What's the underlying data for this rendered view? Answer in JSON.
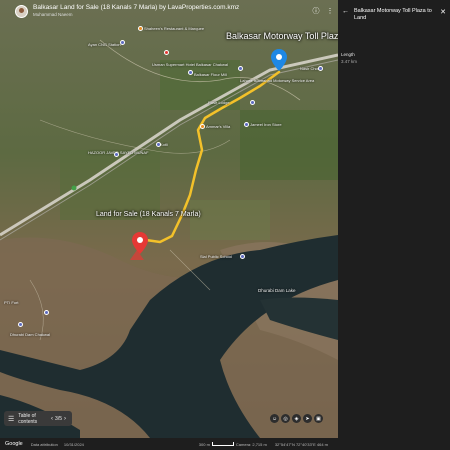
{
  "header": {
    "title": "Balkasar Land for Sale (18 Kanals 7 Marla) by LavaProperties.com.kmz",
    "user": "Muhammad Naeem"
  },
  "map": {
    "labels": {
      "toll_plaza": "Balkasar Motorway Toll Plaza",
      "land_for_sale": "Land for Sale (18 Kanals 7 Marla)",
      "shaheen_restaurant": "Shaheen's Restaurant & Marquee",
      "motorway_service": "Lahore Islamabad Motorway Service Area",
      "usman_mart": "Usman Supermart Hotel Balkasar Chakwal",
      "ayan_cng": "Ayan CNG Station",
      "gym": "Gym",
      "balkasar_mill": "Balkasar Flour Mill",
      "nasir_chowk": "Nasir Chowk",
      "rose_lodge": "Rose Lodge",
      "balkasar_motorway": "Balkasar Motorway",
      "rest_area": "Rest Area",
      "ammar_villa": "Ammar's Villa",
      "jameel_iron": "Jameel Iron Store",
      "hazoor_javed": "HAZOOR JAVED SAYED MUNAF",
      "kotli": "Kotli",
      "sial_public": "Sial Public School",
      "balkasar_chakwal": "Balkasar Chakwal",
      "dhurabi_dam_lake": "Dhurabi Dam Lake",
      "dhurabi_dam_chakwal": "Dhurabi Dam Chakwal",
      "pti_fort": "PTI Fort"
    }
  },
  "toc": {
    "label": "Table of contents",
    "page": "3/5"
  },
  "controls": {
    "icons": [
      "street-view-icon",
      "location-icon",
      "layers-icon",
      "compass-icon",
      "2d-icon"
    ]
  },
  "footer": {
    "brand": "Google",
    "data_attribution": "Data attribution",
    "date": "10/31/2024",
    "scale": "300 m",
    "camera": "Camera: 2,715 m",
    "coords": "32°54'47\"N 72°40'33\"E  464 m"
  },
  "panel": {
    "title": "Balkasar Motorway Toll Plaza to Land",
    "length_label": "Length",
    "length_value": "3.47 km"
  },
  "colors": {
    "route": "#f3c12a",
    "pin_red": "#e53935",
    "pin_blue": "#1e88e5",
    "panel_bg": "#1e1e1e"
  }
}
